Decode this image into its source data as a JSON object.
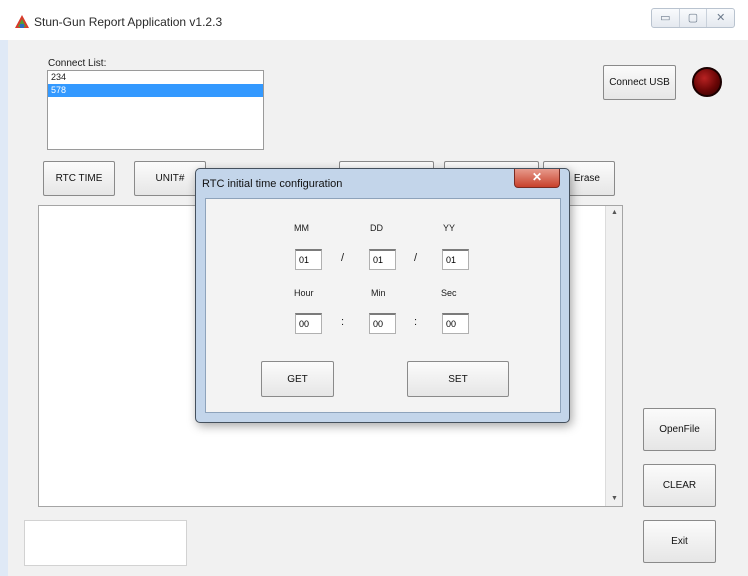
{
  "window": {
    "title": "Stun-Gun Report Application v1.2.3",
    "controls": {
      "minimize": "▭",
      "maximize": "▢",
      "close": "✕"
    }
  },
  "connect": {
    "label": "Connect List:",
    "items": [
      {
        "label": "234",
        "selected": false
      },
      {
        "label": "578",
        "selected": true
      }
    ],
    "usb_button": "Connect USB",
    "status_led_color": "#8b0a0a"
  },
  "toolbar": {
    "rtc_time": "RTC TIME",
    "unit": "UNIT#",
    "erase": "Erase"
  },
  "side_buttons": {
    "open_file": "OpenFile",
    "clear": "CLEAR",
    "exit": "Exit"
  },
  "dialog": {
    "title": "RTC initial time configuration",
    "close": "✕",
    "labels": {
      "mm": "MM",
      "dd": "DD",
      "yy": "YY",
      "hour": "Hour",
      "min": "Min",
      "sec": "Sec"
    },
    "values": {
      "mm": "01",
      "dd": "01",
      "yy": "01",
      "hour": "00",
      "min": "00",
      "sec": "00"
    },
    "date_sep": "/",
    "time_sep": ":",
    "get_button": "GET",
    "set_button": "SET"
  },
  "colors": {
    "selection": "#3399ff",
    "dialog_frame": "#c3d5ea",
    "close_button": "#c8412b"
  }
}
